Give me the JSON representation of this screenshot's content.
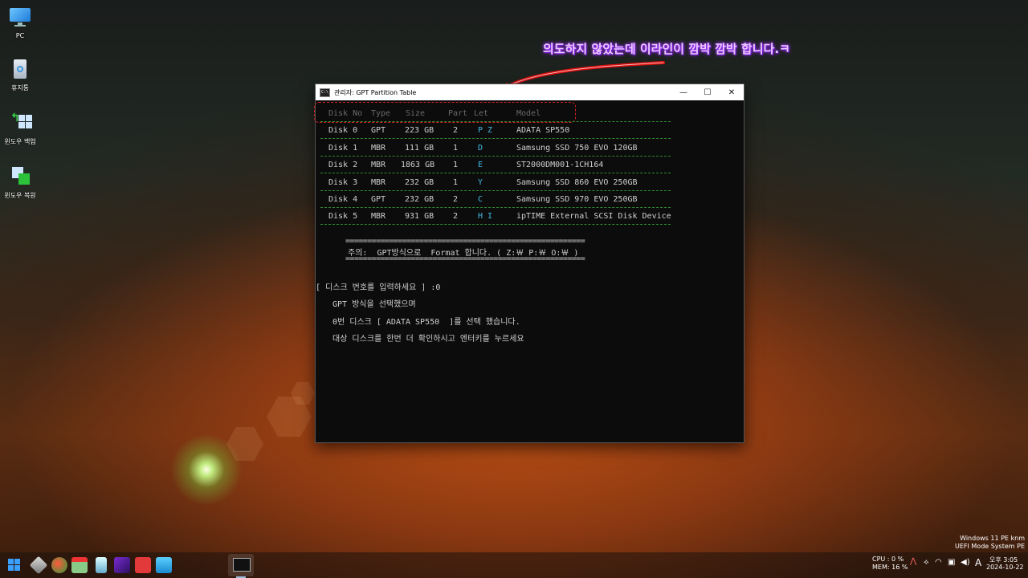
{
  "desktop": {
    "icons": [
      {
        "label": "PC",
        "icon": "monitor-icon"
      },
      {
        "label": "휴지통",
        "icon": "recycle-bin-icon"
      },
      {
        "label": "윈도우 백업",
        "icon": "backup-icon"
      },
      {
        "label": "윈도우 복원",
        "icon": "restore-icon"
      }
    ]
  },
  "annotation": {
    "text": "의도하지 않았는데  이라인이 깜박 깜박 합니다.ㅋ",
    "color": "#e9c8ff",
    "arrow_color": "#e01010"
  },
  "window": {
    "title": "관리자: GPT Partition Table",
    "icon_text": "C:\\",
    "controls": {
      "minimize": "—",
      "maximize": "☐",
      "close": "✕"
    }
  },
  "table": {
    "headers": [
      "Disk No",
      "Type",
      "Size",
      "Part",
      "Let",
      "Model"
    ],
    "rows": [
      [
        "Disk 0",
        "GPT",
        "223 GB",
        "2",
        "P Z",
        "ADATA SP550"
      ],
      [
        "Disk 1",
        "MBR",
        "111 GB",
        "1",
        "D",
        "Samsung SSD 750 EVO 120GB"
      ],
      [
        "Disk 2",
        "MBR",
        "1863 GB",
        "1",
        "E",
        "ST2000DM001-1CH164"
      ],
      [
        "Disk 3",
        "MBR",
        "232 GB",
        "1",
        "Y",
        "Samsung SSD 860 EVO 250GB"
      ],
      [
        "Disk 4",
        "GPT",
        "232 GB",
        "2",
        "C",
        "Samsung SSD 970 EVO 250GB"
      ],
      [
        "Disk 5",
        "MBR",
        "931 GB",
        "2",
        "H I",
        "ipTIME External SCSI Disk Device"
      ]
    ]
  },
  "notice": {
    "rule": "=======================================================",
    "text": "주의:  GPT방식으로  Format 합니다. ( Z:￦ P:￦ O:￦ )"
  },
  "prompts": {
    "input_prompt": "[ 디스크 번호를 입력하세요 ] :0",
    "line1": "GPT 방식을 선택했으며",
    "line2": "0번 디스크 [ ADATA SP550  ]를 선택 했습니다.",
    "line3": "대상 디스크를 한번 더 확인하시고 엔터키를 누르세요"
  },
  "system": {
    "os_line1": "Windows 11 PE knm",
    "os_line2": "UEFI Mode System PE",
    "cpu": "CPU :  0 %",
    "mem": "MEM: 16 %",
    "ime": "A",
    "time": "오후 3:05",
    "date": "2024-10-22"
  },
  "taskbar": {
    "icons": [
      "windows-start-icon",
      "app-icon-1",
      "app-icon-2",
      "app-icon-3",
      "app-icon-4",
      "app-icon-5",
      "app-icon-6",
      "app-icon-7",
      "cmd-icon"
    ]
  }
}
